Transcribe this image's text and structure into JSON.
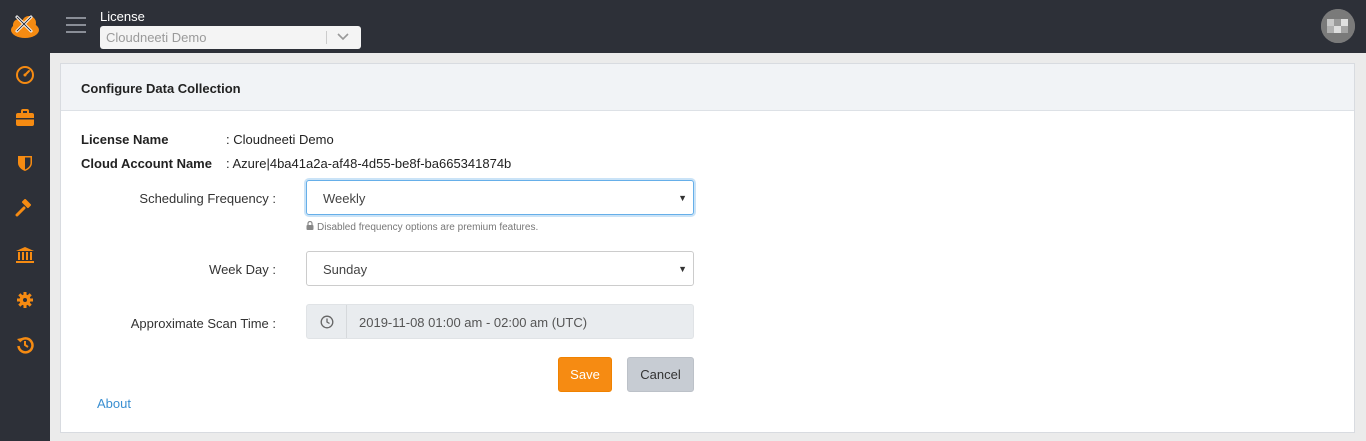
{
  "header": {
    "license_label": "License",
    "license_selected": "Cloudneeti Demo"
  },
  "sidebar": {
    "items": [
      {
        "icon": "dashboard-icon"
      },
      {
        "icon": "briefcase-icon"
      },
      {
        "icon": "shield-icon"
      },
      {
        "icon": "gavel-icon"
      },
      {
        "icon": "bank-icon"
      },
      {
        "icon": "gear-icon"
      },
      {
        "icon": "history-icon"
      }
    ],
    "accent_color": "#f68b12"
  },
  "panel": {
    "title": "Configure Data Collection",
    "license_name_key": "License Name",
    "license_name_value": ": Cloudneeti Demo",
    "cloud_account_key": "Cloud Account Name",
    "cloud_account_value": ": Azure|4ba41a2a-af48-4d55-be8f-ba665341874b",
    "scheduling_label": "Scheduling Frequency :",
    "scheduling_value": "Weekly",
    "scheduling_hint": "Disabled frequency options are premium features.",
    "weekday_label": "Week Day :",
    "weekday_value": "Sunday",
    "scan_time_label": "Approximate Scan Time :",
    "scan_time_value": "2019-11-08 01:00 am - 02:00 am (UTC)",
    "save_label": "Save",
    "cancel_label": "Cancel",
    "about_label": "About"
  }
}
